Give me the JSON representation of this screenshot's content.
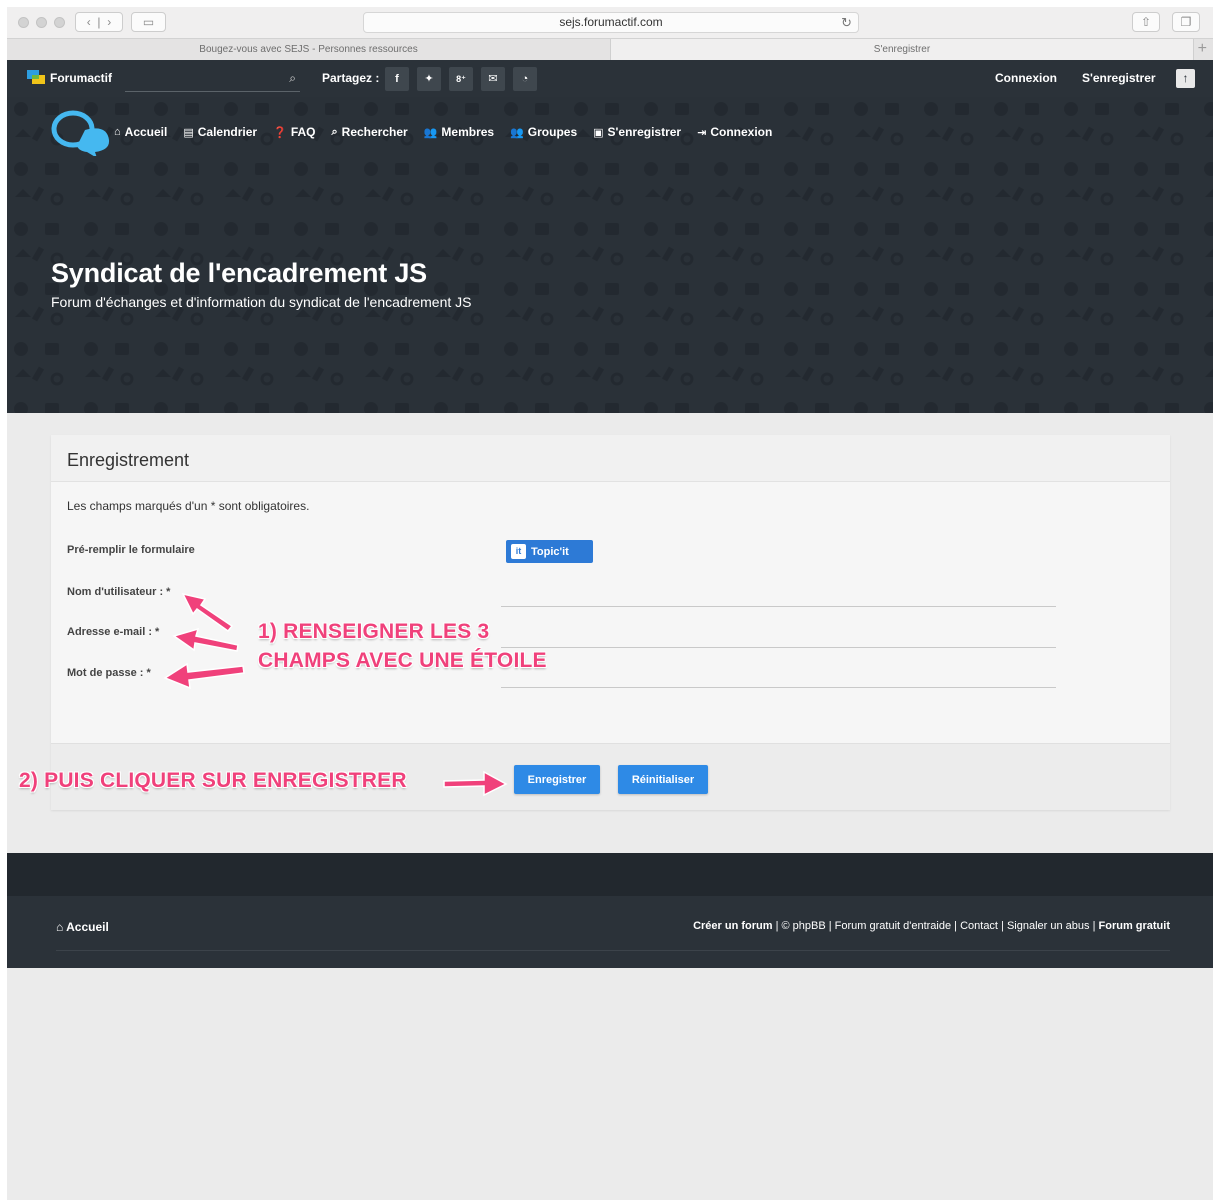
{
  "browser": {
    "url": "sejs.forumactif.com",
    "tabs": [
      {
        "label": "Bougez-vous avec SEJS - Personnes ressources"
      },
      {
        "label": "S'enregistrer"
      }
    ]
  },
  "toolbar": {
    "brand": "Forumactif",
    "search_placeholder": "",
    "share_label": "Partagez :",
    "share_buttons": [
      "f",
      "t",
      "8⁺",
      "✉",
      "rss"
    ],
    "login": "Connexion",
    "register": "S'enregistrer"
  },
  "nav": {
    "items": [
      {
        "label": "Accueil",
        "icon": "home-icon"
      },
      {
        "label": "Calendrier",
        "icon": "calendar-icon"
      },
      {
        "label": "FAQ",
        "icon": "question-icon"
      },
      {
        "label": "Rechercher",
        "icon": "search-icon"
      },
      {
        "label": "Membres",
        "icon": "members-icon"
      },
      {
        "label": "Groupes",
        "icon": "groups-icon"
      },
      {
        "label": "S'enregistrer",
        "icon": "register-icon"
      },
      {
        "label": "Connexion",
        "icon": "login-icon"
      }
    ]
  },
  "header": {
    "title": "Syndicat de l'encadrement JS",
    "description": "Forum d'échanges et d'information du syndicat de l'encadrement JS"
  },
  "form": {
    "title": "Enregistrement",
    "required_note": "Les champs marqués d'un * sont obligatoires.",
    "prefill_label": "Pré-remplir le formulaire",
    "topicit_label": "Topic'it",
    "fields": [
      {
        "label": "Nom d'utilisateur : *",
        "value": ""
      },
      {
        "label": "Adresse e-mail : *",
        "value": ""
      },
      {
        "label": "Mot de passe : *",
        "value": ""
      }
    ],
    "submit_label": "Enregistrer",
    "reset_label": "Réinitialiser"
  },
  "annotations": {
    "step1_line1": "1) RENSEIGNER LES 3",
    "step1_line2": "CHAMPS AVEC UNE ÉTOILE",
    "step2": "2) PUIS CLIQUER SUR ENREGISTRER"
  },
  "footer": {
    "home": "Accueil",
    "links": {
      "create": "Créer un forum",
      "middle": " | © phpBB | Forum gratuit d'entraide | Contact | Signaler un abus | ",
      "free": "Forum gratuit"
    }
  },
  "colors": {
    "accent": "#2e8ae6",
    "annotation": "#f0417b",
    "dark": "#2b3239"
  }
}
